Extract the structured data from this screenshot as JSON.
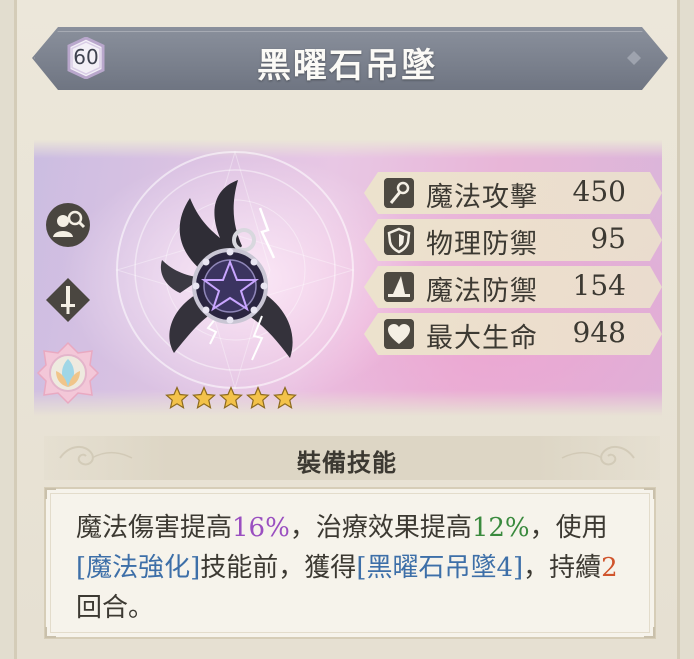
{
  "item": {
    "level": "60",
    "name": "黑曜石吊墜",
    "stars": 5
  },
  "stats": [
    {
      "icon": "wand-icon",
      "name": "魔法攻擊",
      "value": "450"
    },
    {
      "icon": "shield-icon",
      "name": "物理防禦",
      "value": "95"
    },
    {
      "icon": "witch-hat-icon",
      "name": "魔法防禦",
      "value": "154"
    },
    {
      "icon": "heart-icon",
      "name": "最大生命",
      "value": "948"
    }
  ],
  "skill": {
    "section_title": "裝備技能",
    "desc": {
      "p1": "魔法傷害提高",
      "v1": "16%",
      "p2": "，治療效果提高",
      "v2": "12%",
      "p3": "，使用",
      "b1": "[魔法強化]",
      "p4": "技能前，獲得",
      "b2": "[黑曜石吊墜4]",
      "p5": "，持續",
      "v3": "2",
      "p6": "回合。"
    }
  },
  "colors": {
    "banner": "#7b808c",
    "accent_purple": "#9a4fc0",
    "accent_green": "#3a8a3e",
    "accent_blue": "#3d6fa8",
    "accent_red": "#d0542c"
  }
}
